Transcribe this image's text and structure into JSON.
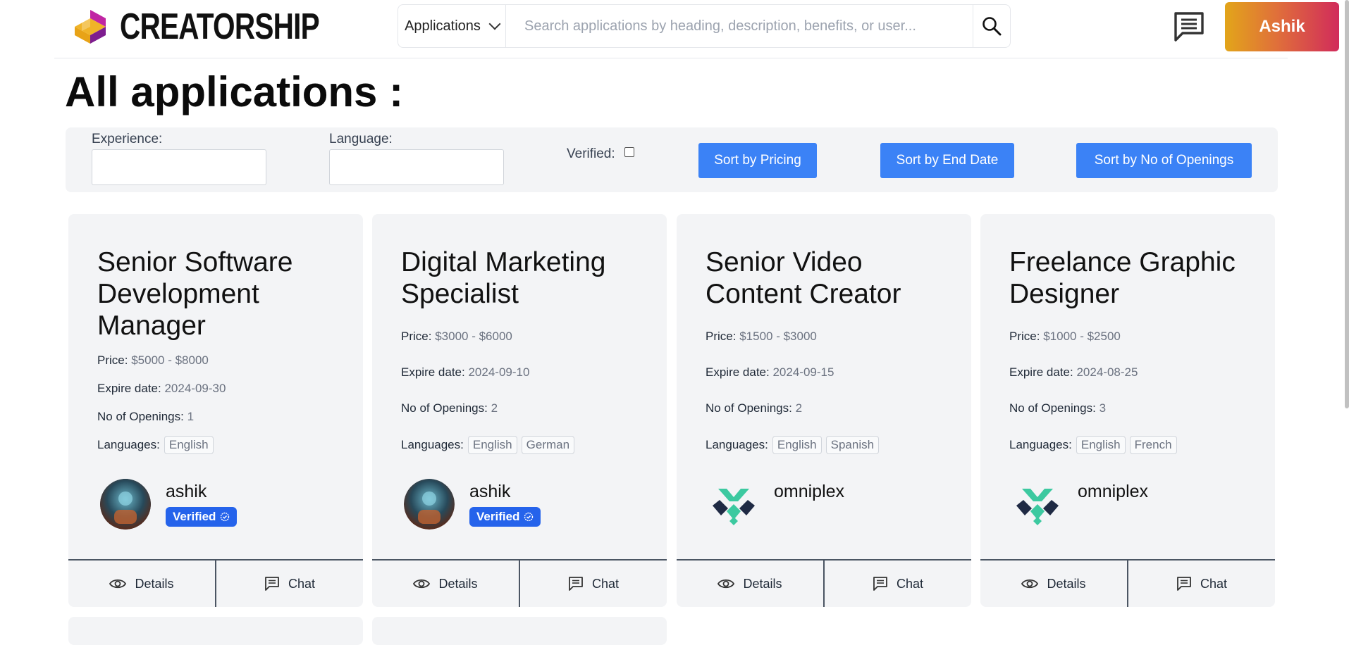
{
  "brand": {
    "name": "CREATORSHIP"
  },
  "search": {
    "category": "Applications",
    "placeholder": "Search applications by heading, description, benefits, or user..."
  },
  "header": {
    "user_label": "Ashik"
  },
  "page": {
    "title": "All applications :"
  },
  "filters": {
    "experience_label": "Experience:",
    "language_label": "Language:",
    "verified_label": "Verified:",
    "sort_pricing": "Sort by Pricing",
    "sort_end_date": "Sort by End Date",
    "sort_openings": "Sort by No of Openings"
  },
  "labels": {
    "price": "Price:",
    "expire": "Expire date:",
    "openings": "No of Openings:",
    "languages": "Languages:",
    "verified": "Verified",
    "details": "Details",
    "chat": "Chat"
  },
  "cards": [
    {
      "title": "Senior Software Development Manager",
      "price": "$5000 - $8000",
      "expire": "2024-09-30",
      "openings": "1",
      "languages": [
        "English"
      ],
      "author": "ashik",
      "verified": true
    },
    {
      "title": "Digital Marketing Specialist",
      "price": "$3000 - $6000",
      "expire": "2024-09-10",
      "openings": "2",
      "languages": [
        "English",
        "German"
      ],
      "author": "ashik",
      "verified": true
    },
    {
      "title": "Senior Video Content Creator",
      "price": "$1500 - $3000",
      "expire": "2024-09-15",
      "openings": "2",
      "languages": [
        "English",
        "Spanish"
      ],
      "author": "omniplex",
      "verified": false
    },
    {
      "title": "Freelance Graphic Designer",
      "price": "$1000 - $2500",
      "expire": "2024-08-25",
      "openings": "3",
      "languages": [
        "English",
        "French"
      ],
      "author": "omniplex",
      "verified": false
    }
  ],
  "icons": {
    "logo": "creatorship-logo-icon",
    "search": "search-icon",
    "message": "message-icon",
    "eye": "eye-icon",
    "chat": "chat-icon",
    "badge": "verified-badge-icon"
  },
  "colors": {
    "primary": "#3b82f6",
    "badge": "#2563eb",
    "accent_start": "#e2a51a",
    "accent_end": "#d12b5b"
  }
}
